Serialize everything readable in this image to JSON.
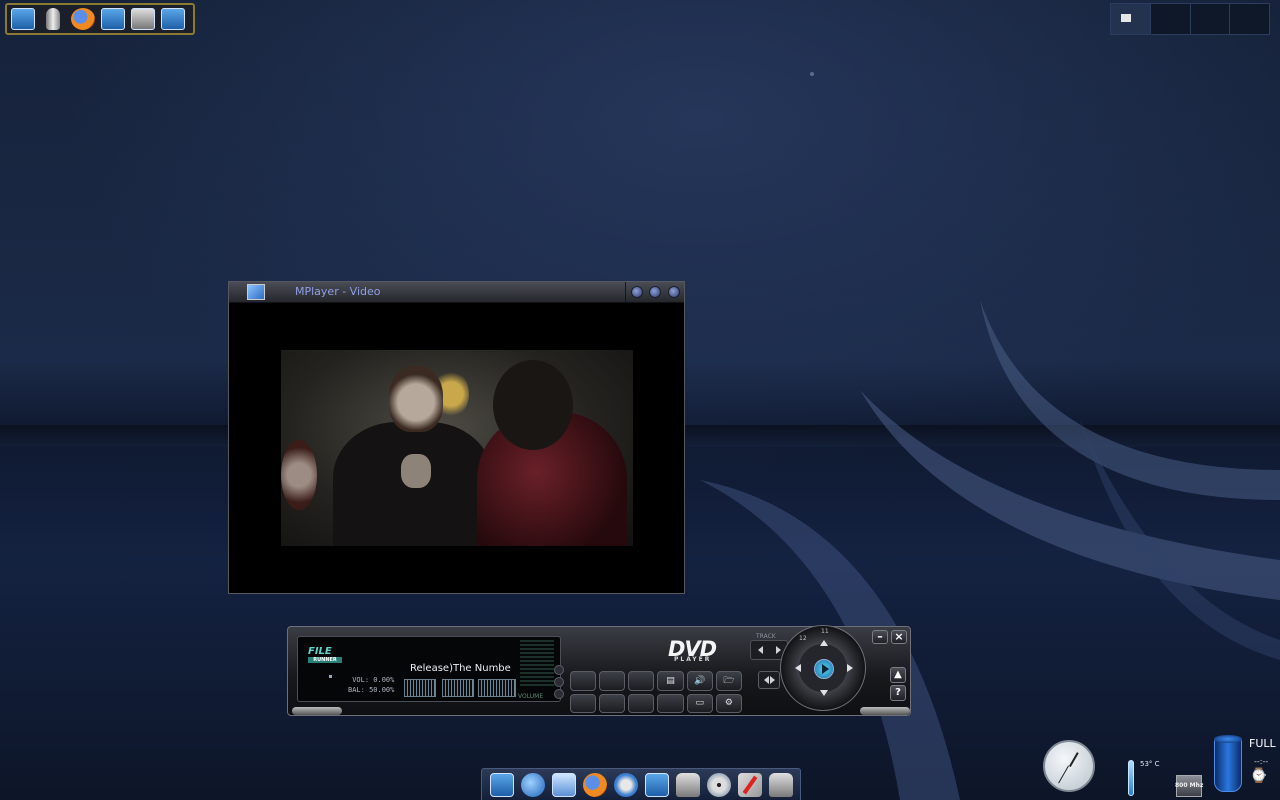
{
  "mplayer": {
    "title": "MPlayer - Video"
  },
  "dvd_player": {
    "file_logo": "FILE",
    "file_logo_sub": "RUNNER",
    "vol_label": "VOL: 0.00%",
    "bal_label": "BAL: 50.00%",
    "marquee": "Release)The Numbe",
    "volume_label": "VOLUME",
    "logo": "DVD",
    "logo_sub": "PLAYER",
    "track_label": "TRACK",
    "jog_top": "11",
    "jog_left": "12",
    "minimize": "–",
    "close": "×",
    "eject": "▲",
    "help": "?",
    "grid_glyphs": [
      "",
      "",
      "",
      "▤",
      "🔊",
      "🗁",
      "",
      "",
      "",
      "",
      "▭",
      "⚙"
    ]
  },
  "widgets": {
    "temperature": "53° C",
    "cpu": "800 Mhz",
    "full_label": "FULL",
    "dashes": "--:--"
  },
  "icons": {
    "launcher": [
      "monitor-icon",
      "disk-icon",
      "firefox-icon",
      "monitor-icon",
      "network-icon",
      "monitor-icon"
    ],
    "dock": [
      "monitor-icon",
      "globe-icon",
      "files-icon",
      "firefox-icon",
      "mail-icon",
      "monitor-icon",
      "printer-icon",
      "cd-icon",
      "paint-icon",
      "archive-icon"
    ]
  },
  "colors": {
    "desktop": "#16223a",
    "title_text": "#8e9ee8",
    "accent": "#5fd6c8"
  }
}
